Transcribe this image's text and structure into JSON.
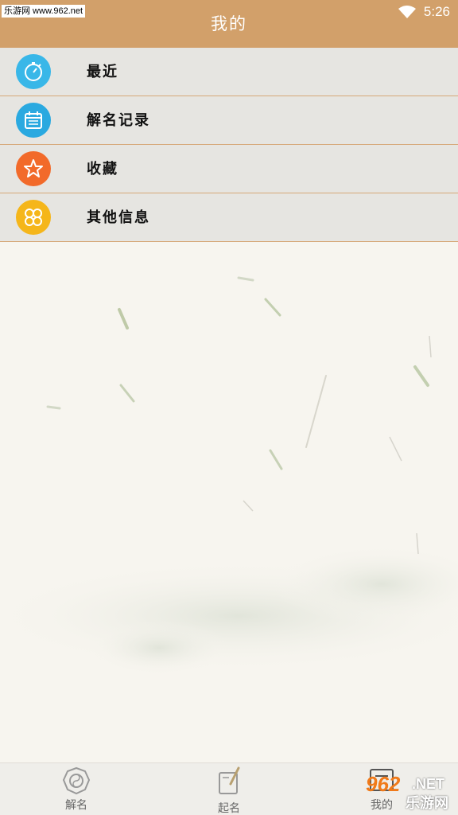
{
  "watermark_top": "乐游网 www.962.net",
  "header": {
    "title": "我的"
  },
  "status": {
    "time": "5:26"
  },
  "menu": [
    {
      "label": "最近",
      "icon": "stopwatch-icon",
      "color": "#39b7e8"
    },
    {
      "label": "解名记录",
      "icon": "calendar-icon",
      "color": "#2aa9e0"
    },
    {
      "label": "收藏",
      "icon": "star-icon",
      "color": "#f26a2a"
    },
    {
      "label": "其他信息",
      "icon": "grid-flower-icon",
      "color": "#f5b61a"
    }
  ],
  "nav": [
    {
      "label": "解名",
      "icon": "bagua-icon"
    },
    {
      "label": "起名",
      "icon": "book-brush-icon"
    },
    {
      "label": "我的",
      "icon": "profile-seal-icon"
    }
  ],
  "watermark_bottom": {
    "num": "962",
    "site": ".NET",
    "cn": "乐游网"
  },
  "colors": {
    "header": "#d2a06a",
    "divider": "#d6a878",
    "row_bg": "#e6e5e1"
  }
}
